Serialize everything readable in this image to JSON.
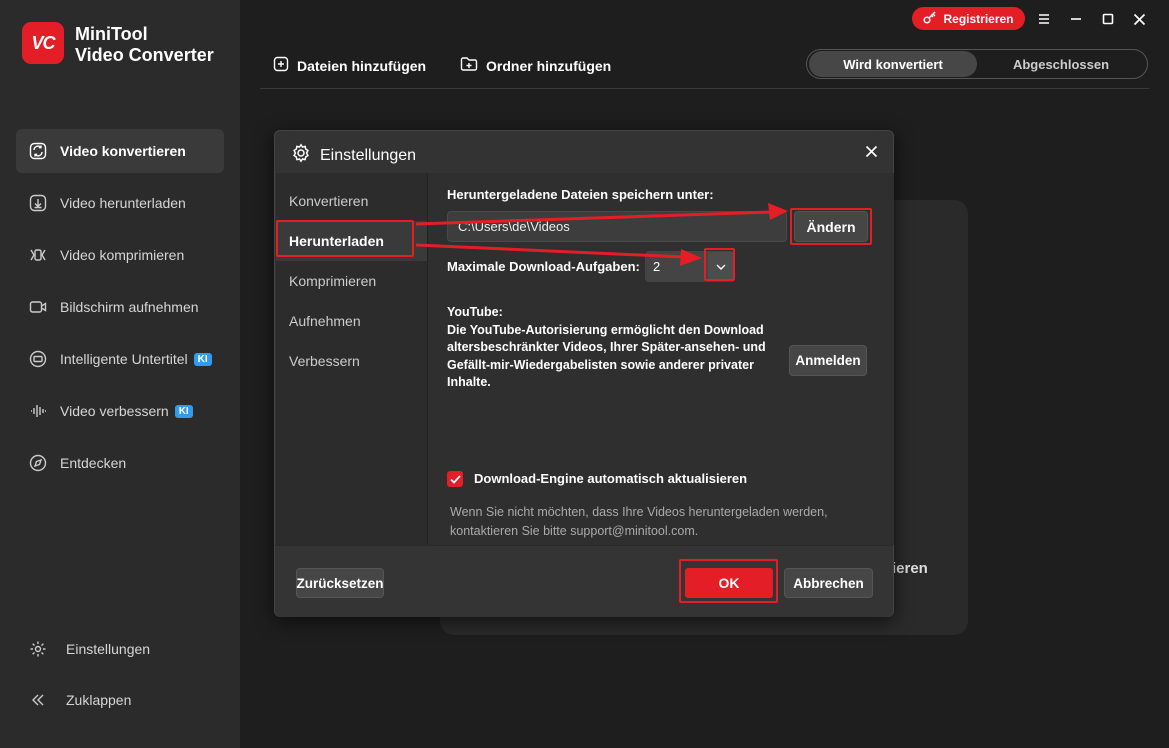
{
  "app": {
    "logo_text": "VC",
    "name_line1": "MiniTool",
    "name_line2": "Video Converter"
  },
  "sidebar": {
    "items": [
      {
        "label": "Video konvertieren",
        "icon": "convert-icon",
        "active": true
      },
      {
        "label": "Video herunterladen",
        "icon": "download-icon"
      },
      {
        "label": "Video komprimieren",
        "icon": "compress-icon"
      },
      {
        "label": "Bildschirm aufnehmen",
        "icon": "camera-icon"
      },
      {
        "label": "Intelligente Untertitel",
        "icon": "subtitle-icon",
        "badge": "KI"
      },
      {
        "label": "Video verbessern",
        "icon": "waveform-icon",
        "badge": "KI"
      },
      {
        "label": "Entdecken",
        "icon": "compass-icon"
      }
    ],
    "settings_label": "Einstellungen",
    "collapse_label": "Zuklappen"
  },
  "topbar": {
    "register_label": "Registrieren",
    "add_files_label": "Dateien hinzufügen",
    "add_folder_label": "Ordner hinzufügen",
    "tab_converting": "Wird konvertiert",
    "tab_done": "Abgeschlossen"
  },
  "background": {
    "partial_text": "tieren"
  },
  "dialog": {
    "title": "Einstellungen",
    "tabs": [
      "Konvertieren",
      "Herunterladen",
      "Komprimieren",
      "Aufnehmen",
      "Verbessern"
    ],
    "active_tab": "Herunterladen",
    "save_label": "Heruntergeladene Dateien speichern unter:",
    "save_path": "C:\\Users\\de\\Videos",
    "change_label": "Ändern",
    "max_label": "Maximale Download-Aufgaben:",
    "max_value": "2",
    "yt_title": "YouTube:",
    "yt_text": "Die YouTube-Autorisierung ermöglicht den Download altersbeschränkter Videos, Ihrer Später-ansehen- und Gefällt-mir-Wiedergabelisten sowie anderer privater Inhalte.",
    "login_label": "Anmelden",
    "auto_update_label": "Download-Engine automatisch aktualisieren",
    "auto_update_checked": true,
    "note": "Wenn Sie nicht möchten, dass Ihre Videos heruntergeladen werden, kontaktieren Sie bitte support@minitool.com.",
    "reset_label": "Zurücksetzen",
    "ok_label": "OK",
    "cancel_label": "Abbrechen"
  },
  "colors": {
    "accent": "#e41e26",
    "sidebar_bg": "#2b2b2b",
    "main_bg": "#1e1e1e",
    "ki_badge": "#2f9cf0"
  }
}
